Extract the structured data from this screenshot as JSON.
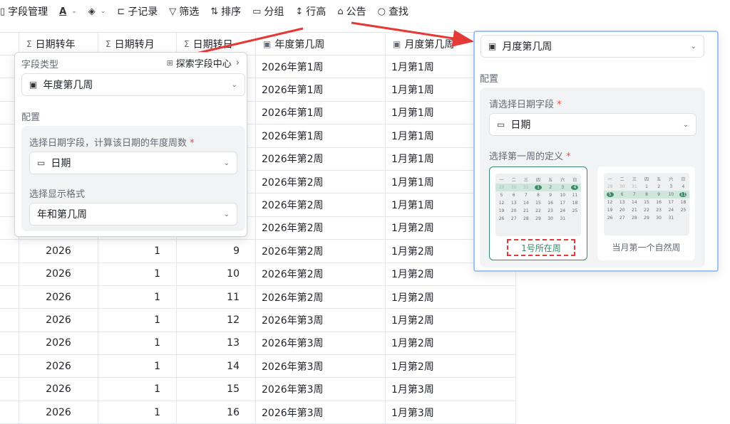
{
  "toolbar": {
    "items": [
      "字段管理",
      "子记录",
      "筛选",
      "排序",
      "分组",
      "行高",
      "公告",
      "查找"
    ]
  },
  "table": {
    "headers": [
      "日期转年",
      "日期转月",
      "日期转日",
      "年度第几周",
      "月度第几周"
    ],
    "rows": [
      [
        "",
        "",
        "",
        "2026年第1周",
        "1月第1周"
      ],
      [
        "",
        "",
        "",
        "2026年第1周",
        "1月第1周"
      ],
      [
        "",
        "",
        "",
        "2026年第1周",
        "1月第1周"
      ],
      [
        "",
        "",
        "",
        "2026年第1周",
        "1月第1周"
      ],
      [
        "",
        "",
        "",
        "2026年第2周",
        "1月第1周"
      ],
      [
        "",
        "",
        "",
        "2026年第2周",
        "1月第1周"
      ],
      [
        "",
        "",
        "",
        "2026年第2周",
        "1月第1周"
      ],
      [
        "",
        "",
        "",
        "2026年第2周",
        "1月第2周"
      ],
      [
        "2026",
        "1",
        "9",
        "2026年第2周",
        "1月第2周"
      ],
      [
        "2026",
        "1",
        "10",
        "2026年第2周",
        "1月第2周"
      ],
      [
        "2026",
        "1",
        "11",
        "2026年第2周",
        "1月第2周"
      ],
      [
        "2026",
        "1",
        "12",
        "2026年第3周",
        "1月第2周"
      ],
      [
        "2026",
        "1",
        "13",
        "2026年第3周",
        "1月第2周"
      ],
      [
        "2026",
        "1",
        "14",
        "2026年第3周",
        "1月第2周"
      ],
      [
        "2026",
        "1",
        "15",
        "2026年第3周",
        "1月第3周"
      ],
      [
        "2026",
        "1",
        "16",
        "2026年第3周",
        "1月第3周"
      ]
    ]
  },
  "panel_year": {
    "field_type_label": "字段类型",
    "explore_link": "探索字段中心",
    "type_value": "年度第几周",
    "config_label": "配置",
    "date_field_label": "选择日期字段，计算该日期的年度周数",
    "date_field_value": "日期",
    "format_label": "选择显示格式",
    "format_value": "年和第几周"
  },
  "panel_month": {
    "type_value": "月度第几周",
    "config_label": "配置",
    "date_field_label": "请选择日期字段",
    "date_field_value": "日期",
    "first_week_label": "选择第一周的定义",
    "option1": "1号所在周",
    "option2": "当月第一个自然周",
    "weekdays": [
      "一",
      "二",
      "三",
      "四",
      "五",
      "六",
      "日"
    ],
    "cal_rows": [
      [
        "29",
        "30",
        "31",
        "1",
        "2",
        "3",
        "4"
      ],
      [
        "5",
        "6",
        "7",
        "8",
        "9",
        "10",
        "11"
      ],
      [
        "12",
        "13",
        "14",
        "15",
        "16",
        "17",
        "18"
      ],
      [
        "19",
        "20",
        "21",
        "22",
        "23",
        "24",
        "25"
      ],
      [
        "26",
        "27",
        "28",
        "29",
        "30",
        "31",
        "1"
      ]
    ]
  },
  "colors": {
    "accent_green": "#3a8a6b",
    "arrow_red": "#e53935",
    "focus_blue": "#9cc3f5"
  }
}
